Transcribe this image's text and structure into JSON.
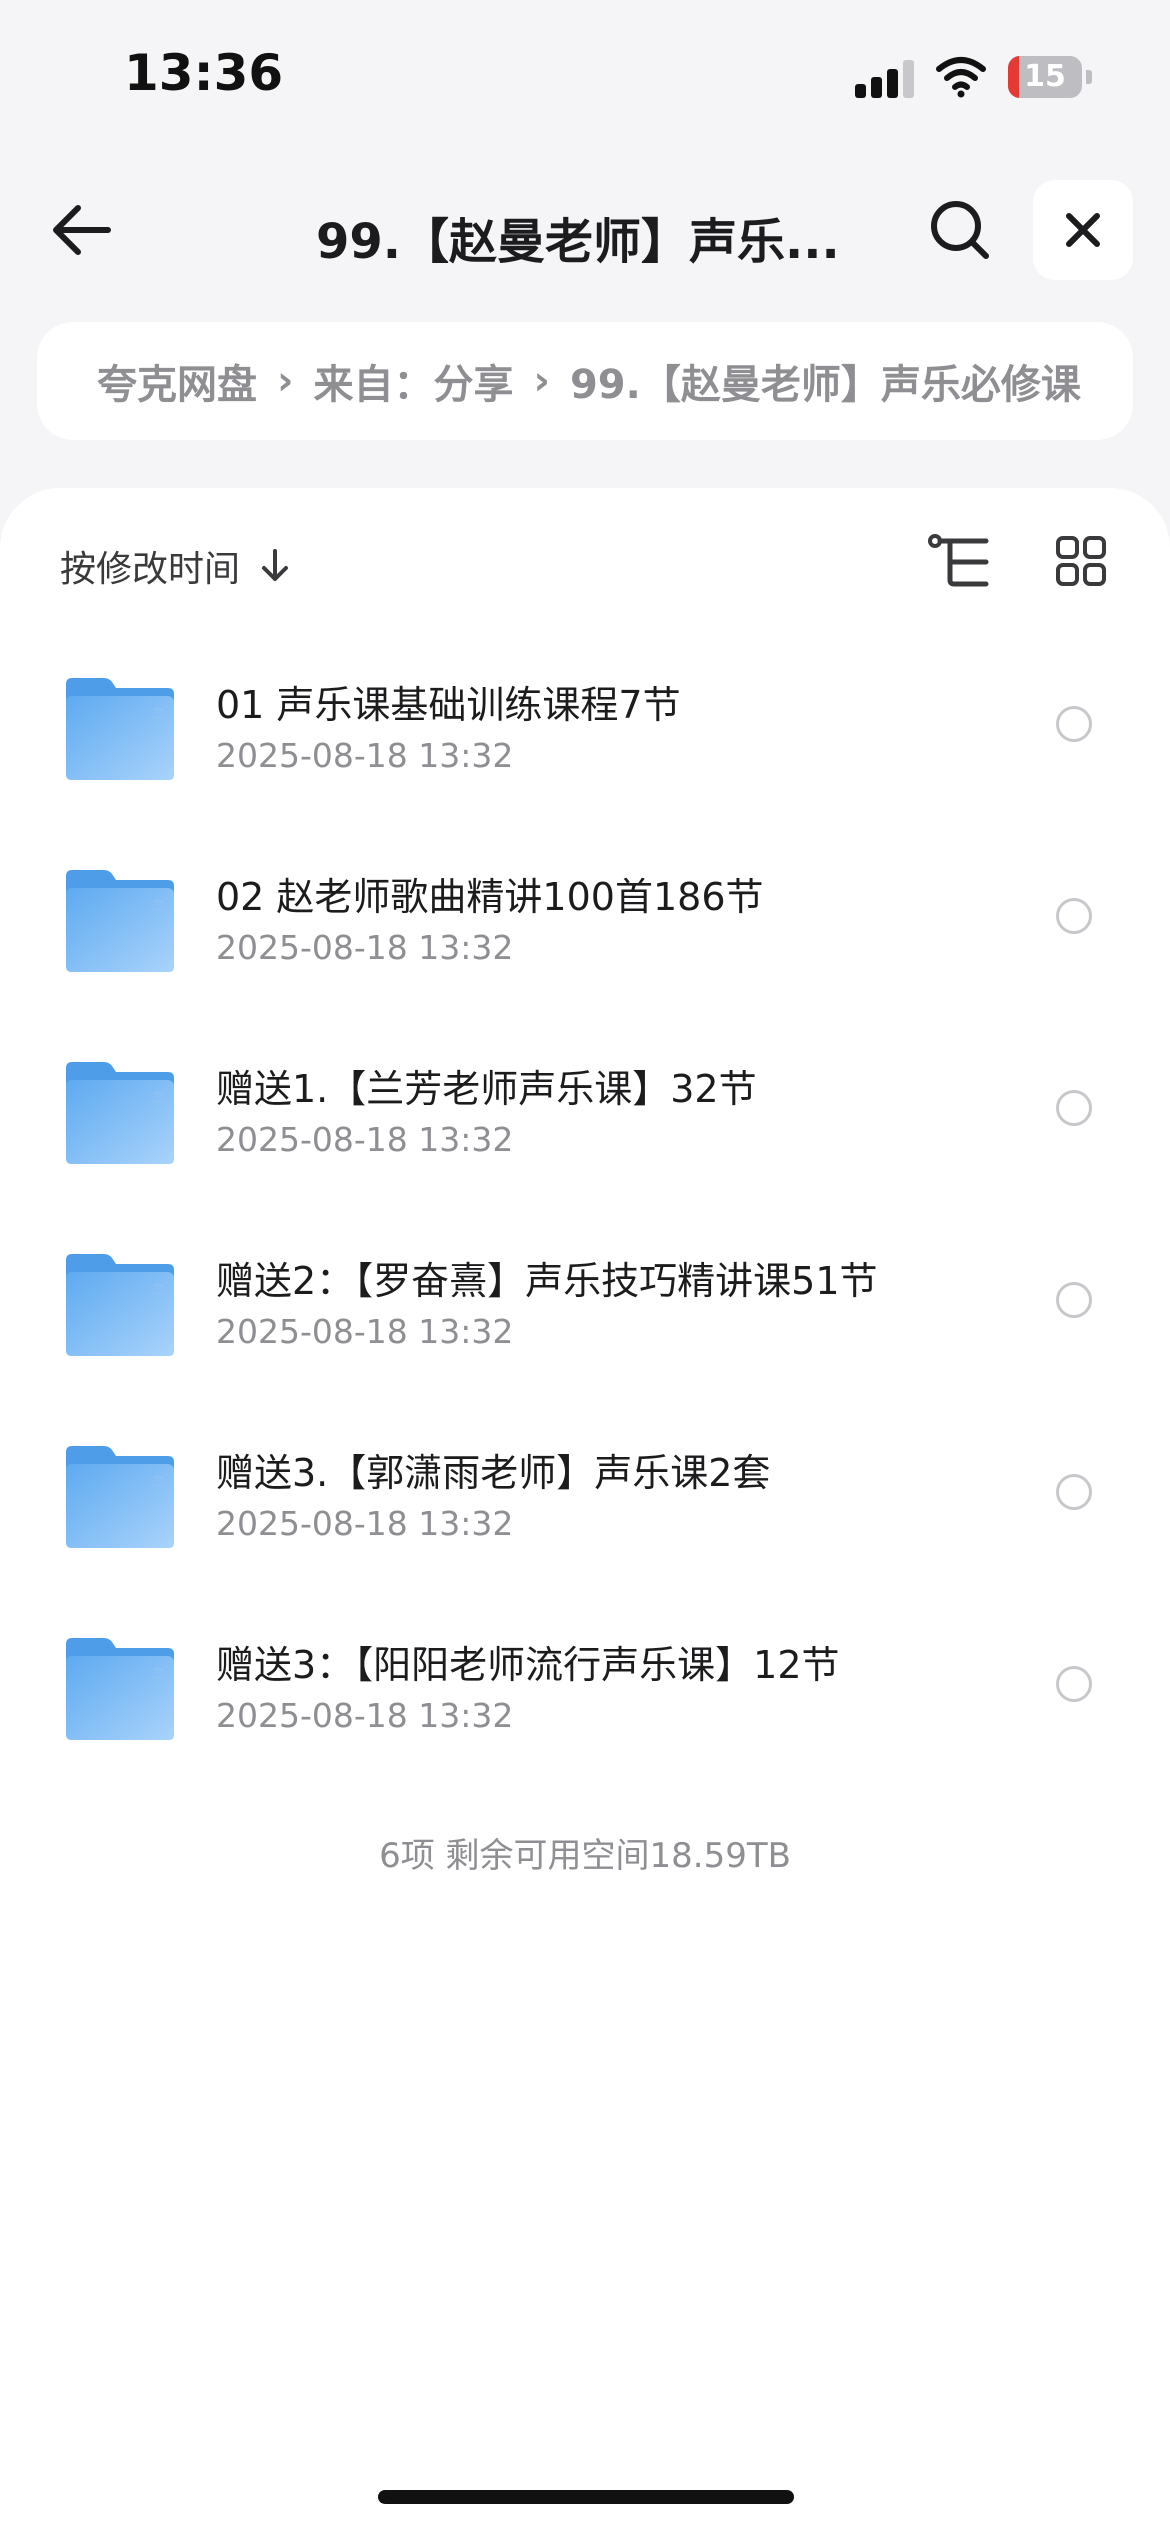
{
  "status": {
    "time": "13:36",
    "battery": "15",
    "battery_level": 0.15
  },
  "nav": {
    "title": "99.【赵曼老师】声乐...",
    "back_icon": "arrow-left-icon",
    "search_icon": "search-icon",
    "close_icon": "close-icon"
  },
  "breadcrumb": {
    "items": [
      "夸克网盘",
      "来自：分享",
      "99.【赵曼老师】声乐必修课"
    ]
  },
  "toolbar": {
    "sort_label": "按修改时间",
    "sort_icon": "arrow-down-icon",
    "tree_icon": "tree-view-icon",
    "grid_icon": "grid-view-icon"
  },
  "files": [
    {
      "name": "01 声乐课基础训练课程7节",
      "date": "2025-08-18 13:32"
    },
    {
      "name": "02 赵老师歌曲精讲100首186节",
      "date": "2025-08-18 13:32"
    },
    {
      "name": "赠送1.【兰芳老师声乐课】32节",
      "date": "2025-08-18 13:32"
    },
    {
      "name": "赠送2：【罗奋熹】声乐技巧精讲课51节",
      "date": "2025-08-18 13:32"
    },
    {
      "name": "赠送3.【郭潇雨老师】声乐课2套",
      "date": "2025-08-18 13:32"
    },
    {
      "name": "赠送3：【阳阳老师流行声乐课】12节",
      "date": "2025-08-18 13:32"
    }
  ],
  "footer": {
    "summary": "6项 剩余可用空间18.59TB"
  },
  "colors": {
    "accent_folder": "#79b8f5",
    "background": "#f5f5f7",
    "battery_low": "#e53935"
  }
}
